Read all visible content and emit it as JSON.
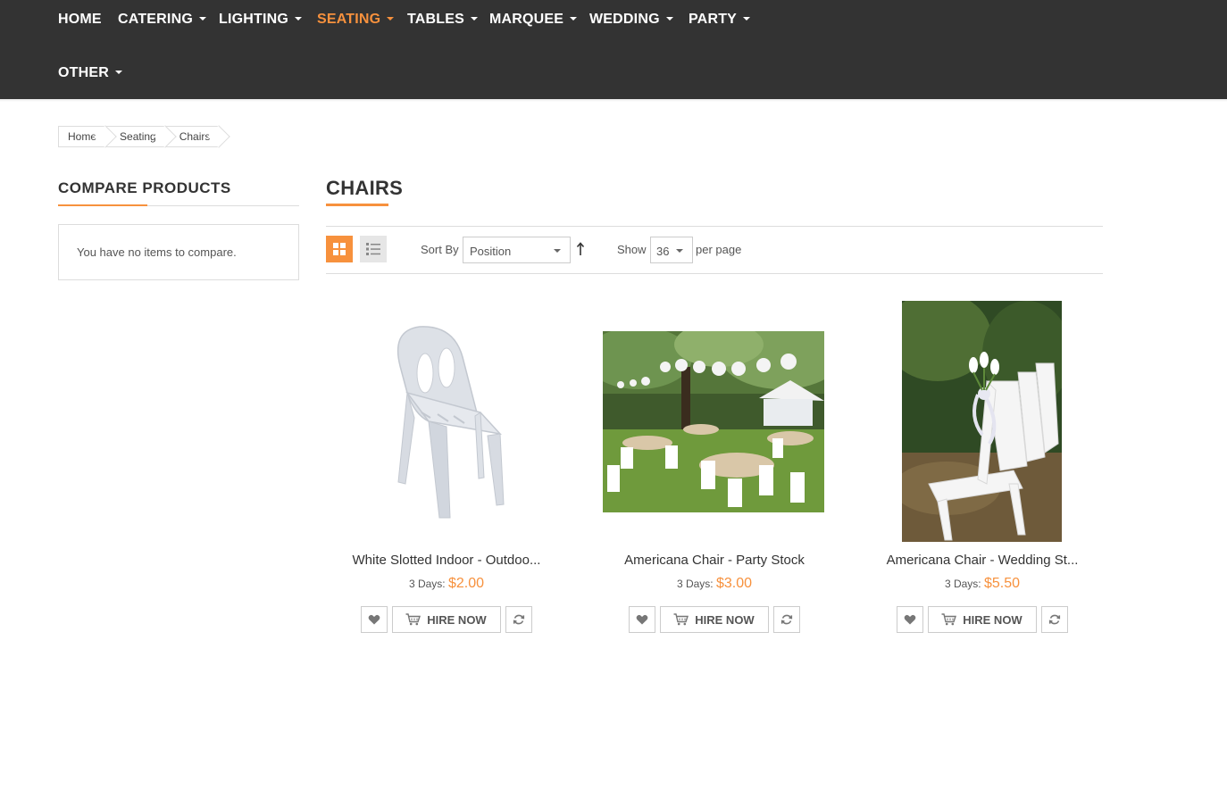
{
  "nav": {
    "items": [
      {
        "label": "HOME",
        "has_dropdown": false,
        "active": false
      },
      {
        "label": "CATERING",
        "has_dropdown": true,
        "active": false
      },
      {
        "label": "LIGHTING",
        "has_dropdown": true,
        "active": false
      },
      {
        "label": "SEATING",
        "has_dropdown": true,
        "active": true
      },
      {
        "label": "TABLES",
        "has_dropdown": true,
        "active": false
      },
      {
        "label": "MARQUEE",
        "has_dropdown": true,
        "active": false
      },
      {
        "label": "WEDDING",
        "has_dropdown": true,
        "active": false
      },
      {
        "label": "PARTY",
        "has_dropdown": true,
        "active": false
      },
      {
        "label": "OTHER",
        "has_dropdown": true,
        "active": false
      }
    ],
    "background_color": "#333333",
    "active_color": "#f7913d"
  },
  "breadcrumb": [
    "Home",
    "Seating",
    "Chairs"
  ],
  "sidebar": {
    "title": "COMPARE PRODUCTS",
    "empty_message": "You have no items to compare."
  },
  "main": {
    "title": "CHAIRS",
    "toolbar": {
      "grid_view_icon": "grid-icon",
      "list_view_icon": "list-icon",
      "sort_label": "Sort By",
      "sort_value": "Position",
      "sort_direction_icon": "arrow-up-icon",
      "show_label": "Show",
      "show_value": "36",
      "per_page_label": "per page"
    }
  },
  "products": [
    {
      "name": "White Slotted Indoor - Outdoo...",
      "price_label": "3 Days:",
      "price": "$2.00",
      "hire_label": "HIRE NOW",
      "image": "white-plastic-chair"
    },
    {
      "name": "Americana Chair - Party Stock",
      "price_label": "3 Days:",
      "price": "$3.00",
      "hire_label": "HIRE NOW",
      "image": "garden-party-chairs"
    },
    {
      "name": "Americana Chair - Wedding St...",
      "price_label": "3 Days:",
      "price": "$5.50",
      "hire_label": "HIRE NOW",
      "image": "wedding-white-chairs"
    }
  ],
  "colors": {
    "accent": "#f7913d",
    "text": "#333333",
    "border": "#dddddd"
  }
}
